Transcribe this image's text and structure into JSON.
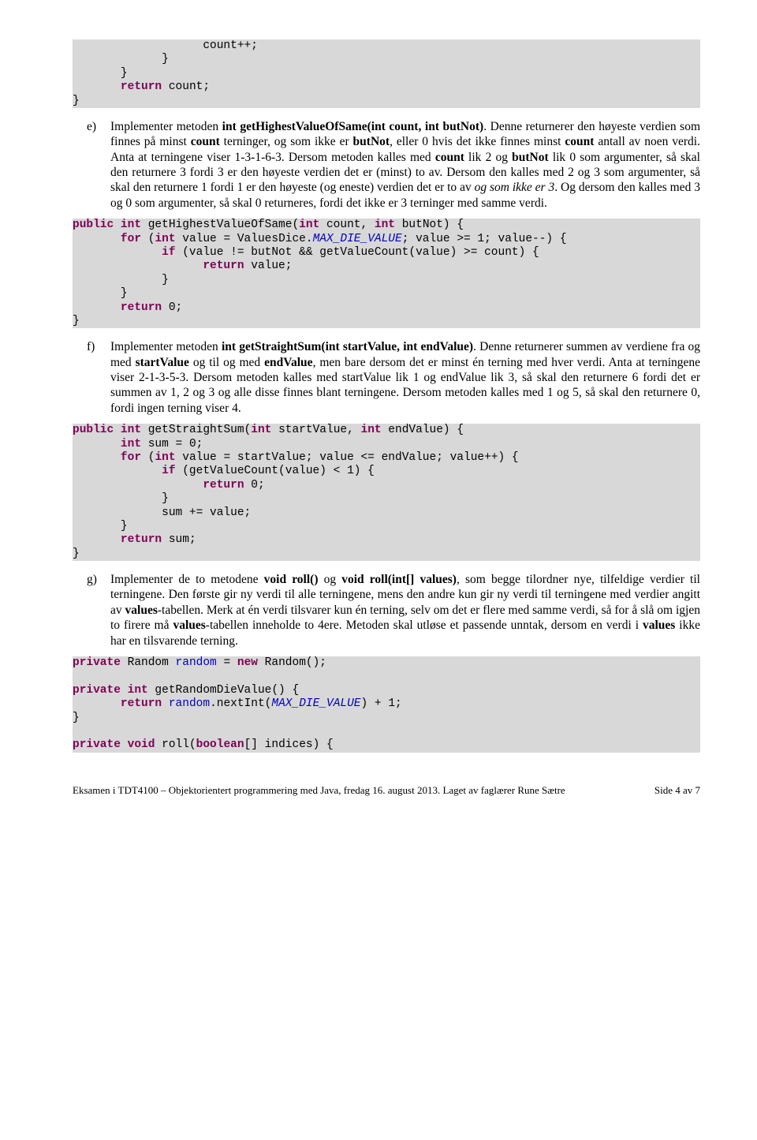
{
  "code1": {
    "l1": "                   count++;",
    "l2": "             }",
    "l3": "       }",
    "l4a": "       ",
    "l4_kw": "return",
    "l4b": " count;",
    "l5": "}"
  },
  "paraE": {
    "letter": "e)",
    "t1": "Implementer metoden ",
    "b1": "int getHighestValueOfSame(int count, int butNot)",
    "t2": ". Denne returnerer den høyeste verdien som finnes på minst ",
    "b2": "count",
    "t3": " terninger, og som ikke er ",
    "b3": "butNot",
    "t4": ", eller 0 hvis det ikke finnes minst ",
    "b4": "count",
    "t5": " antall av noen verdi. Anta at terningene viser 1-3-1-6-3. Dersom metoden kalles med ",
    "b5": "count",
    "t6": " lik 2 og ",
    "b6": "butNot",
    "t7": " lik 0 som argumenter, så skal den returnere 3 fordi 3 er den høyeste verdien det er (minst) to av. Dersom den kalles med 2 og 3 som argumenter, så skal den returnere 1 fordi 1 er den høyeste (og eneste) verdien det er to av ",
    "i1": "og som ikke er 3",
    "t8": ". Og dersom den kalles med 3 og 0 som argumenter, så skal 0 returneres, fordi det ikke er 3 terninger med samme verdi."
  },
  "code2": {
    "l1_kw1": "public",
    "l1a": " ",
    "l1_kw2": "int",
    "l1b": " getHighestValueOfSame(",
    "l1_kw3": "int",
    "l1c": " count, ",
    "l1_kw4": "int",
    "l1d": " butNot) {",
    "l2a": "       ",
    "l2_kw1": "for",
    "l2b": " (",
    "l2_kw2": "int",
    "l2c": " value = ValuesDice.",
    "l2_const": "MAX_DIE_VALUE",
    "l2d": "; value >= 1; value--) {",
    "l3a": "             ",
    "l3_kw": "if",
    "l3b": " (value != butNot && getValueCount(value) >= count) {",
    "l4a": "                   ",
    "l4_kw": "return",
    "l4b": " value;",
    "l5": "             }",
    "l6": "       }",
    "l7a": "       ",
    "l7_kw": "return",
    "l7b": " 0;",
    "l8": "}"
  },
  "paraF": {
    "letter": "f)",
    "t1": "Implementer metoden ",
    "b1": "int getStraightSum(int startValue, int endValue)",
    "t2": ". Denne returnerer summen av verdiene fra og med ",
    "b2": "startValue",
    "t3": " og til og med ",
    "b3": "endValue",
    "t4": ", men bare dersom det er minst én terning med hver verdi. Anta at terningene viser 2-1-3-5-3. Dersom metoden kalles med startValue lik 1 og endValue lik 3, så skal den returnere 6 fordi det er summen av 1, 2 og 3 og alle disse finnes blant terningene. Dersom metoden kalles med 1 og 5, så skal den returnere 0, fordi ingen terning viser 4."
  },
  "code3": {
    "l1_kw1": "public",
    "l1a": " ",
    "l1_kw2": "int",
    "l1b": " getStraightSum(",
    "l1_kw3": "int",
    "l1c": " startValue, ",
    "l1_kw4": "int",
    "l1d": " endValue) {",
    "l2a": "       ",
    "l2_kw": "int",
    "l2b": " sum = 0;",
    "l3a": "       ",
    "l3_kw1": "for",
    "l3b": " (",
    "l3_kw2": "int",
    "l3c": " value = startValue; value <= endValue; value++) {",
    "l4a": "             ",
    "l4_kw": "if",
    "l4b": " (getValueCount(value) < 1) {",
    "l5a": "                   ",
    "l5_kw": "return",
    "l5b": " 0;",
    "l6": "             }",
    "l7": "             sum += value;",
    "l8": "       }",
    "l9a": "       ",
    "l9_kw": "return",
    "l9b": " sum;",
    "l10": "}"
  },
  "paraG": {
    "letter": "g)",
    "t1": "Implementer de to metodene ",
    "b1": "void roll()",
    "t2": " og ",
    "b2": "void roll(int[] values)",
    "t3": ", som begge tilordner nye, tilfeldige verdier til terningene. Den første gir ny verdi til alle terningene, mens den andre kun gir ny verdi til terningene med verdier angitt av ",
    "b3": "values",
    "t4": "-tabellen. Merk at én verdi tilsvarer kun én terning, selv om det er flere med samme verdi, så for å slå om igjen to firere må ",
    "b4": "values",
    "t5": "-tabellen inneholde to 4ere. Metoden skal utløse et passende unntak, dersom en verdi i ",
    "b5": "values",
    "t6": " ikke har en tilsvarende terning."
  },
  "code4": {
    "l1_kw1": "private",
    "l1a": " Random ",
    "l1_f1": "random",
    "l1b": " = ",
    "l1_kw2": "new",
    "l1c": " Random();",
    "blank": " ",
    "l2_kw1": "private",
    "l2a": " ",
    "l2_kw2": "int",
    "l2b": " getRandomDieValue() {",
    "l3a": "       ",
    "l3_kw": "return",
    "l3b": " ",
    "l3_f": "random",
    "l3c": ".nextInt(",
    "l3_const": "MAX_DIE_VALUE",
    "l3d": ") + 1;",
    "l4": "}",
    "l5_kw1": "private",
    "l5a": " ",
    "l5_kw2": "void",
    "l5b": " roll(",
    "l5_kw3": "boolean",
    "l5c": "[] indices) {"
  },
  "footer": {
    "left": "Eksamen i TDT4100 – Objektorientert programmering med Java, fredag 16. august 2013. Laget av faglærer Rune Sætre",
    "right": "Side 4 av 7"
  }
}
